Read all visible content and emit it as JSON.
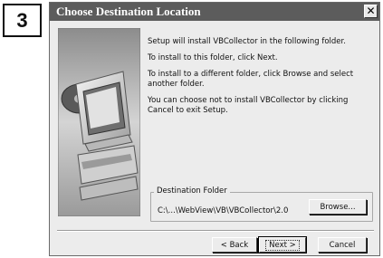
{
  "step_badge": "3",
  "dialog": {
    "title": "Choose Destination Location",
    "close_glyph": "✕"
  },
  "content": {
    "para1": "Setup will install VBCollector in the following folder.",
    "para2": "To install to this folder, click Next.",
    "para3": "To install to a different folder, click Browse and select another folder.",
    "para4": "You can choose not to install VBCollector by clicking Cancel to exit Setup."
  },
  "destination": {
    "group_label": "Destination Folder",
    "path": "C:\\...\\WebView\\VB\\VBCollector\\2.0",
    "browse_label": "Browse..."
  },
  "buttons": {
    "back_label": "< Back",
    "next_label": "Next >",
    "cancel_label": "Cancel"
  },
  "icons": {
    "side_image": "computer-with-cd-icon"
  }
}
